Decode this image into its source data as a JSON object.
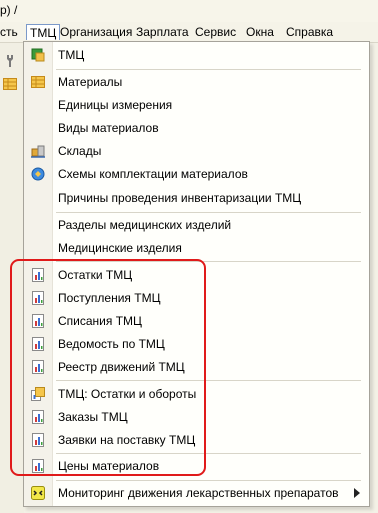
{
  "title_fragment": "р) /",
  "menubar": {
    "items": [
      {
        "label": "сть"
      },
      {
        "label": "ТМЦ"
      },
      {
        "label": "Организация"
      },
      {
        "label": "Зарплата"
      },
      {
        "label": "Сервис"
      },
      {
        "label": "Окна"
      },
      {
        "label": "Справка"
      }
    ]
  },
  "menu": {
    "items": [
      {
        "label": "ТМЦ",
        "icon": "tmc-register-icon"
      },
      {
        "label": "Материалы",
        "icon": "table-icon"
      },
      {
        "label": "Единицы измерения"
      },
      {
        "label": "Виды материалов"
      },
      {
        "label": "Склады",
        "icon": "warehouse-icon"
      },
      {
        "label": "Схемы комплектации материалов",
        "icon": "kit-scheme-icon"
      },
      {
        "label": "Причины проведения инвентаризации ТМЦ"
      },
      {
        "label": "Разделы медицинских изделий"
      },
      {
        "label": "Медицинские изделия"
      },
      {
        "label": "Остатки ТМЦ",
        "icon": "report-icon"
      },
      {
        "label": "Поступления ТМЦ",
        "icon": "report-icon"
      },
      {
        "label": "Списания ТМЦ",
        "icon": "report-icon"
      },
      {
        "label": "Ведомость по ТМЦ",
        "icon": "report-icon"
      },
      {
        "label": "Реестр движений ТМЦ",
        "icon": "report-icon"
      },
      {
        "label": "ТМЦ: Остатки и обороты",
        "icon": "cube-report-icon"
      },
      {
        "label": "Заказы ТМЦ",
        "icon": "report-icon"
      },
      {
        "label": "Заявки на поставку ТМЦ",
        "icon": "report-icon"
      },
      {
        "label": "Цены материалов",
        "icon": "report-icon"
      },
      {
        "label": "Мониторинг движения лекарственных препаратов",
        "icon": "monitoring-icon",
        "submenu": true
      }
    ]
  },
  "colors": {
    "highlight_border": "#e01a1a",
    "menu_active_border": "#7b99c9"
  }
}
